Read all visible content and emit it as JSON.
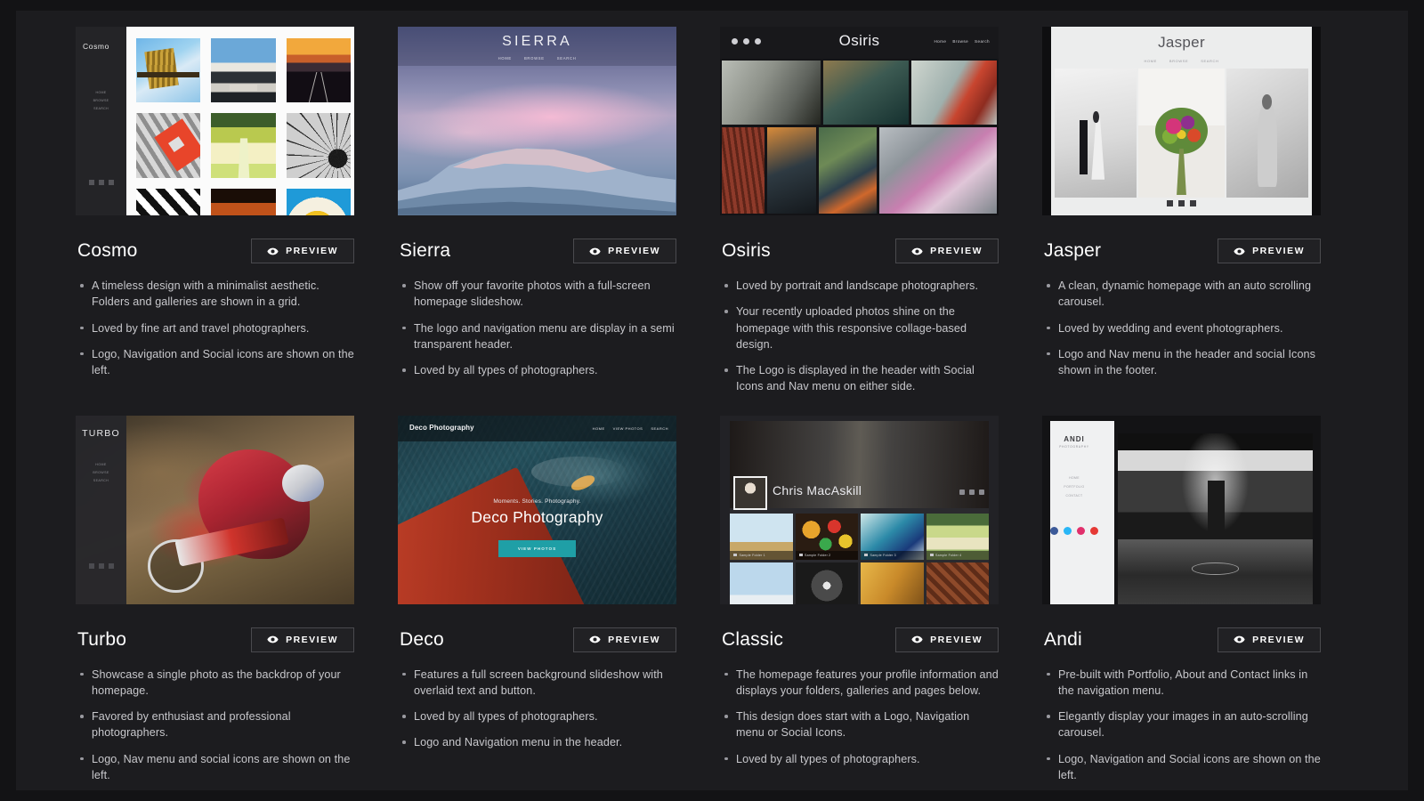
{
  "page": {
    "background_color": "#1c1c1f",
    "outer_color": "#131315",
    "text_color": "#c8c8cc"
  },
  "preview_button": {
    "label": "PREVIEW",
    "icon": "eye-icon",
    "border_color": "#4a4a4e"
  },
  "cards": [
    {
      "id": "cosmo",
      "title": "Cosmo",
      "features": [
        "A timeless design with a minimalist aesthetic. Folders and galleries are shown in a grid.",
        "Loved by fine art and travel photographers.",
        "Logo, Navigation and Social icons are shown on the left."
      ],
      "thumb": {
        "logo": "Cosmo",
        "nav": [
          "HOME",
          "BROWSE",
          "SEARCH"
        ],
        "layout": "left-sidebar-grid"
      }
    },
    {
      "id": "sierra",
      "title": "Sierra",
      "features": [
        "Show off your favorite photos with a full-screen homepage slideshow.",
        "The logo and navigation menu are display in a semi transparent header.",
        "Loved by all types of photographers."
      ],
      "thumb": {
        "logo": "SIERRA",
        "nav": [
          "HOME",
          "BROWSE",
          "SEARCH"
        ],
        "layout": "fullscreen-slideshow"
      }
    },
    {
      "id": "osiris",
      "title": "Osiris",
      "features": [
        "Loved by portrait and landscape photographers.",
        "Your recently uploaded photos shine on the homepage with this responsive collage-based design.",
        "The Logo is displayed in the header with Social Icons and Nav menu on either side."
      ],
      "thumb": {
        "logo": "Osiris",
        "nav": [
          "Home",
          "Browse",
          "Search"
        ],
        "layout": "collage"
      }
    },
    {
      "id": "jasper",
      "title": "Jasper",
      "features": [
        "A clean, dynamic homepage with an auto scrolling carousel.",
        "Loved by wedding and event photographers.",
        "Logo and Nav menu in the header and social Icons shown in the footer."
      ],
      "thumb": {
        "logo": "Jasper",
        "nav": [
          "HOME",
          "BROWSE",
          "SEARCH"
        ],
        "layout": "light-carousel"
      }
    },
    {
      "id": "turbo",
      "title": "Turbo",
      "features": [
        "Showcase a single photo as the backdrop of your homepage.",
        "Favored by enthusiast and professional photographers.",
        "Logo, Nav menu and social icons are shown on the left."
      ],
      "thumb": {
        "logo": "TURBO",
        "nav": [
          "HOME",
          "BROWSE",
          "SEARCH"
        ],
        "layout": "left-sidebar-photo"
      }
    },
    {
      "id": "deco",
      "title": "Deco",
      "features": [
        "Features a full screen background slideshow with overlaid text and button.",
        "Loved by all types of photographers.",
        "Logo and Navigation menu in the header."
      ],
      "thumb": {
        "logo": "Deco Photography",
        "nav": [
          "HOME",
          "VIEW PHOTOS",
          "SEARCH"
        ],
        "tagline": "Moments. Stories. Photography.",
        "headline": "Deco Photography",
        "cta": "VIEW PHOTOS",
        "cta_color": "#1f9fa6",
        "layout": "hero-overlay"
      }
    },
    {
      "id": "classic",
      "title": "Classic",
      "features": [
        "The homepage features your profile information and displays your folders, galleries and pages below.",
        "This design does start with a Logo, Navigation menu or Social Icons.",
        "Loved by all types of photographers."
      ],
      "thumb": {
        "profile_name": "Chris MacAskill",
        "folder_captions": [
          "Sample Folder 1",
          "Sample Folder 2",
          "Sample Folder 3",
          "Sample Folder 4"
        ],
        "layout": "profile-cover"
      }
    },
    {
      "id": "andi",
      "title": "Andi",
      "features": [
        "Pre-built with Portfolio, About and Contact links in the navigation menu.",
        "Elegantly display your images in an auto-scrolling carousel.",
        "Logo, Navigation and Social icons are shown on the left."
      ],
      "thumb": {
        "logo": "ANDI",
        "sublogo": "PHOTOGRAPHY",
        "nav": [
          "HOME",
          "PORTFOLIO",
          "CONTACT"
        ],
        "social_colors": [
          "#3b5998",
          "#29b6f6",
          "#e1306c",
          "#e53935"
        ],
        "layout": "light-sidebar-photo"
      }
    }
  ]
}
